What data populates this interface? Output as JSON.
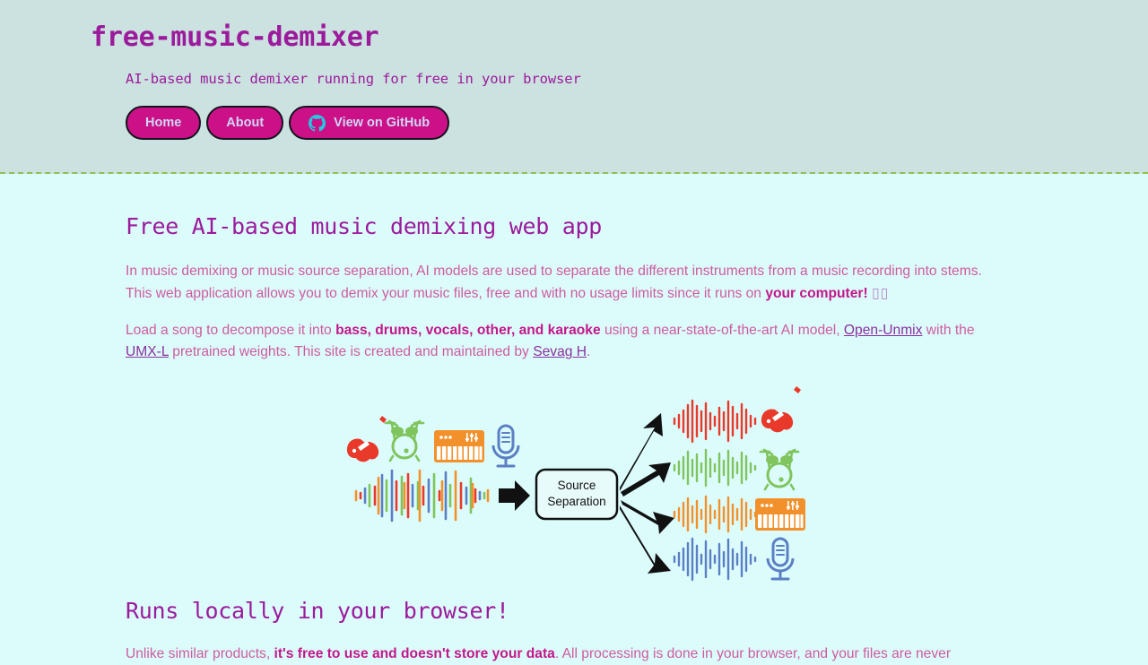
{
  "header": {
    "title": "free-music-demixer",
    "subtitle": "AI-based music demixer running for free in your browser",
    "nav": [
      {
        "label": "Home",
        "name": "nav-home"
      },
      {
        "label": "About",
        "name": "nav-about"
      },
      {
        "label": "View on GitHub",
        "name": "nav-github",
        "icon": "github-icon"
      }
    ],
    "bg_color": "#cbe2e0",
    "accent_color": "#cc1188",
    "border_color": "#8fbf4f"
  },
  "main": {
    "heading": "Free AI-based music demixing web app",
    "paragraph1": {
      "part1": "In music demixing or music source separation, AI models are used to separate the different instruments from a music recording into stems. This web application allows you to demix your music files, free and with no usage limits since it runs on ",
      "bold1": "your computer!",
      "emoji": "▯▯"
    },
    "paragraph2": {
      "part1": "Load a song to decompose it into ",
      "bold1": "bass, drums, vocals, other, and karaoke",
      "part2": " using a near-state-of-the-art AI model, ",
      "link1": "Open-Unmix",
      "part3": " with the ",
      "link2": "UMX-L",
      "part4": " pretrained weights. This site is created and maintained by ",
      "link3": "Sevag H",
      "part5": "."
    },
    "heading2": "Runs locally in your browser!",
    "paragraph3": {
      "part1": "Unlike similar products, ",
      "bold1": "it's free to use and doesn't store your data",
      "part2": ". All processing is done in your browser, and your files are never"
    },
    "text_color": "#cf5a9e",
    "heading_color": "#9c1a9c",
    "link_color": "#8b2f9e",
    "bg_color": "#dcfcfc"
  },
  "diagram": {
    "box_label_line1": "Source",
    "box_label_line2": "Separation",
    "inputs": [
      {
        "name": "electric-guitar-icon",
        "color": "#e8392a"
      },
      {
        "name": "drum-kit-icon",
        "color": "#7fc45c"
      },
      {
        "name": "keyboard-icon",
        "color": "#f2912b"
      },
      {
        "name": "microphone-icon",
        "color": "#5b7fc4"
      }
    ],
    "outputs": [
      {
        "name": "electric-guitar-icon",
        "color": "#e8392a",
        "waveform": "bass-waveform"
      },
      {
        "name": "drum-kit-icon",
        "color": "#7fc45c",
        "waveform": "drums-waveform"
      },
      {
        "name": "keyboard-icon",
        "color": "#f2912b",
        "waveform": "other-waveform"
      },
      {
        "name": "microphone-icon",
        "color": "#5b7fc4",
        "waveform": "vocals-waveform"
      }
    ],
    "mixed_waveform_colors": [
      "#e8392a",
      "#5b7fc4",
      "#7fc45c",
      "#f2912b"
    ]
  }
}
